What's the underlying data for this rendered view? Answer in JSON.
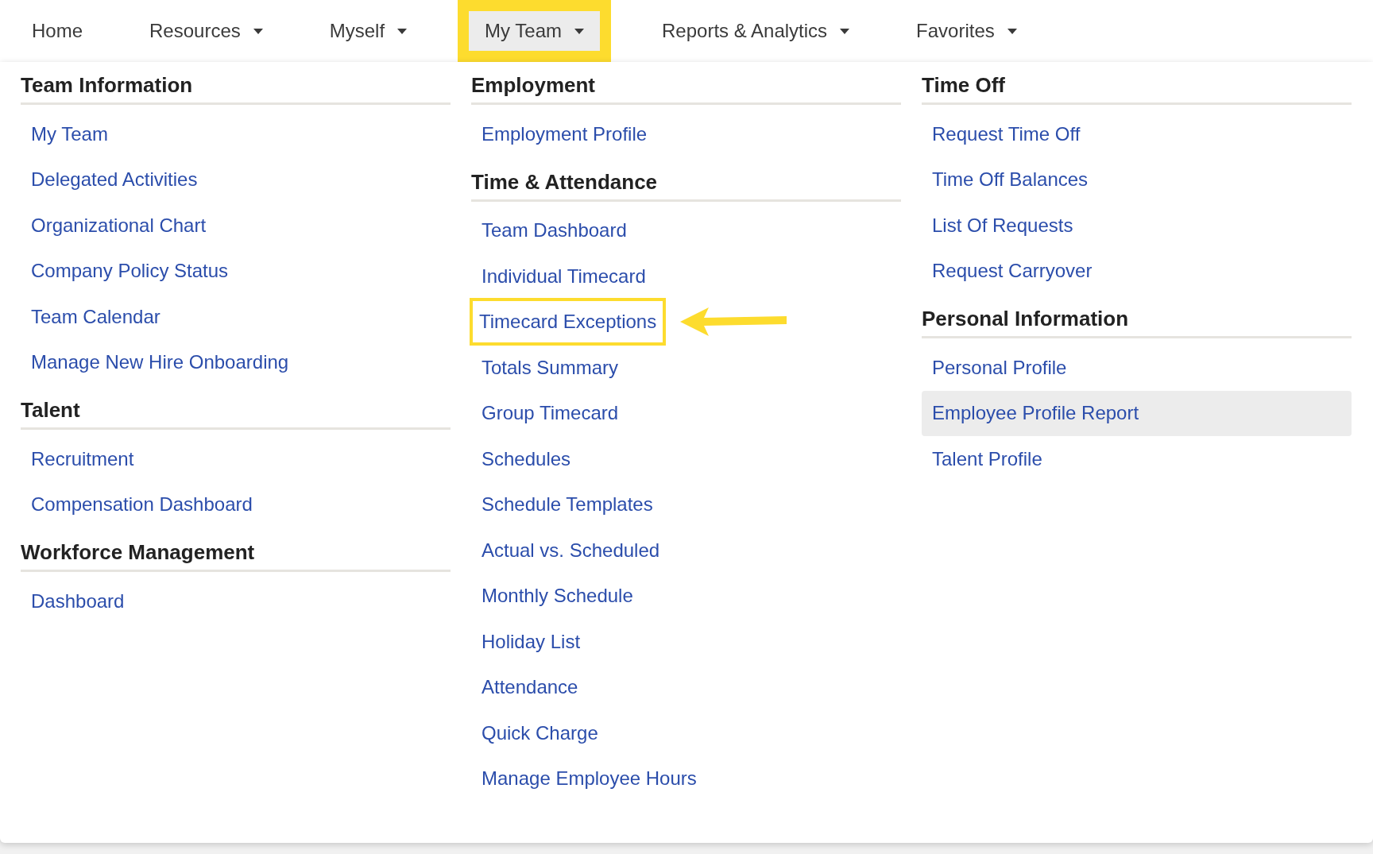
{
  "nav": [
    {
      "label": "Home",
      "caret": false,
      "selected": false,
      "annotated": false
    },
    {
      "label": "Resources",
      "caret": true,
      "selected": false,
      "annotated": false
    },
    {
      "label": "Myself",
      "caret": true,
      "selected": false,
      "annotated": false
    },
    {
      "label": "My Team",
      "caret": true,
      "selected": true,
      "annotated": true
    },
    {
      "label": "Reports & Analytics",
      "caret": true,
      "selected": false,
      "annotated": false
    },
    {
      "label": "Favorites",
      "caret": true,
      "selected": false,
      "annotated": false
    }
  ],
  "columns": [
    {
      "sections": [
        {
          "heading": "Team Information",
          "items": [
            {
              "label": "My Team",
              "highlighted": false,
              "annotated": false
            },
            {
              "label": "Delegated Activities",
              "highlighted": false,
              "annotated": false
            },
            {
              "label": "Organizational Chart",
              "highlighted": false,
              "annotated": false
            },
            {
              "label": "Company Policy Status",
              "highlighted": false,
              "annotated": false
            },
            {
              "label": "Team Calendar",
              "highlighted": false,
              "annotated": false
            },
            {
              "label": "Manage New Hire Onboarding",
              "highlighted": false,
              "annotated": false
            }
          ]
        },
        {
          "heading": "Talent",
          "items": [
            {
              "label": "Recruitment",
              "highlighted": false,
              "annotated": false
            },
            {
              "label": "Compensation Dashboard",
              "highlighted": false,
              "annotated": false
            }
          ]
        },
        {
          "heading": "Workforce Management",
          "items": [
            {
              "label": "Dashboard",
              "highlighted": false,
              "annotated": false
            }
          ]
        }
      ]
    },
    {
      "sections": [
        {
          "heading": "Employment",
          "items": [
            {
              "label": "Employment Profile",
              "highlighted": false,
              "annotated": false
            }
          ]
        },
        {
          "heading": "Time & Attendance",
          "items": [
            {
              "label": "Team Dashboard",
              "highlighted": false,
              "annotated": false
            },
            {
              "label": "Individual Timecard",
              "highlighted": false,
              "annotated": false
            },
            {
              "label": "Timecard Exceptions",
              "highlighted": false,
              "annotated": true
            },
            {
              "label": "Totals Summary",
              "highlighted": false,
              "annotated": false
            },
            {
              "label": "Group Timecard",
              "highlighted": false,
              "annotated": false
            },
            {
              "label": "Schedules",
              "highlighted": false,
              "annotated": false
            },
            {
              "label": "Schedule Templates",
              "highlighted": false,
              "annotated": false
            },
            {
              "label": "Actual vs. Scheduled",
              "highlighted": false,
              "annotated": false
            },
            {
              "label": "Monthly Schedule",
              "highlighted": false,
              "annotated": false
            },
            {
              "label": "Holiday List",
              "highlighted": false,
              "annotated": false
            },
            {
              "label": "Attendance",
              "highlighted": false,
              "annotated": false
            },
            {
              "label": "Quick Charge",
              "highlighted": false,
              "annotated": false
            },
            {
              "label": "Manage Employee Hours",
              "highlighted": false,
              "annotated": false
            }
          ]
        }
      ]
    },
    {
      "sections": [
        {
          "heading": "Time Off",
          "items": [
            {
              "label": "Request Time Off",
              "highlighted": false,
              "annotated": false
            },
            {
              "label": "Time Off Balances",
              "highlighted": false,
              "annotated": false
            },
            {
              "label": "List Of Requests",
              "highlighted": false,
              "annotated": false
            },
            {
              "label": "Request Carryover",
              "highlighted": false,
              "annotated": false
            }
          ]
        },
        {
          "heading": "Personal Information",
          "items": [
            {
              "label": "Personal Profile",
              "highlighted": false,
              "annotated": false
            },
            {
              "label": "Employee Profile Report",
              "highlighted": true,
              "annotated": false
            },
            {
              "label": "Talent Profile",
              "highlighted": false,
              "annotated": false
            }
          ]
        }
      ]
    }
  ]
}
